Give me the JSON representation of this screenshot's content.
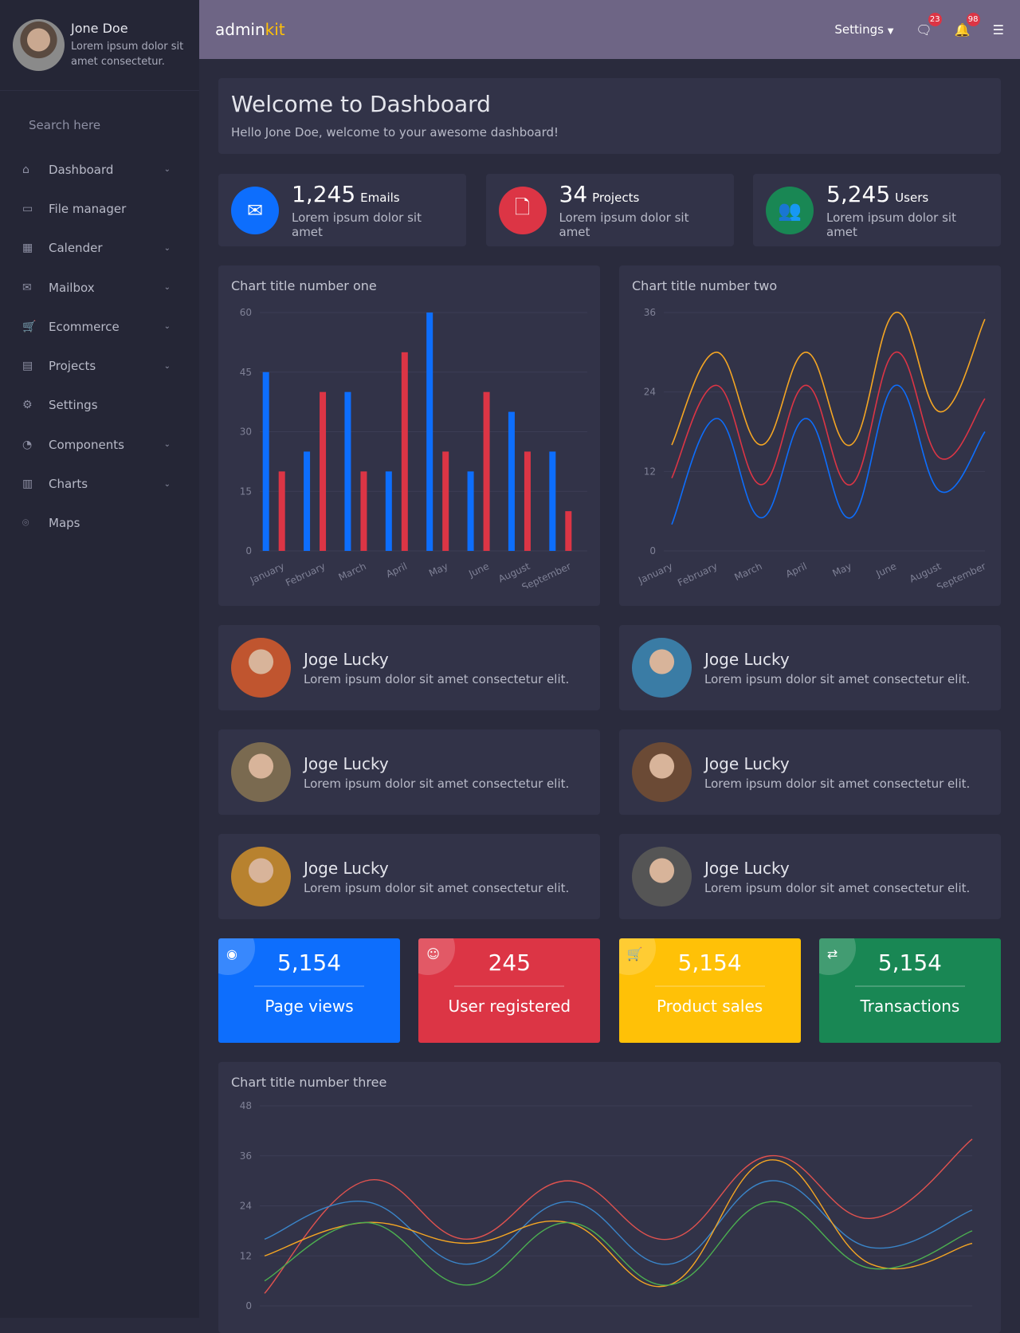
{
  "sidebar": {
    "user": {
      "name": "Jone Doe",
      "desc": "Lorem ipsum dolor sit amet consectetur."
    },
    "search_placeholder": "Search here",
    "items": [
      {
        "label": "Dashboard",
        "icon": "home-icon",
        "chevron": true
      },
      {
        "label": "File manager",
        "icon": "folder-icon",
        "chevron": false
      },
      {
        "label": "Calender",
        "icon": "calendar-icon",
        "chevron": true
      },
      {
        "label": "Mailbox",
        "icon": "mailbox-icon",
        "chevron": true
      },
      {
        "label": "Ecommerce",
        "icon": "cart-icon",
        "chevron": true
      },
      {
        "label": "Projects",
        "icon": "briefcase-icon",
        "chevron": true
      },
      {
        "label": "Settings",
        "icon": "gear-icon",
        "chevron": false
      },
      {
        "label": "Components",
        "icon": "pie-icon",
        "chevron": true
      },
      {
        "label": "Charts",
        "icon": "bar-chart-icon",
        "chevron": true
      },
      {
        "label": "Maps",
        "icon": "map-pin-icon",
        "chevron": false
      }
    ]
  },
  "header": {
    "brand_a": "admin",
    "brand_b": "kit",
    "settings": "Settings",
    "messages_count": "23",
    "notifications_count": "98"
  },
  "welcome": {
    "title": "Welcome to Dashboard",
    "subtitle": "Hello Jone Doe, welcome to your awesome dashboard!"
  },
  "stats": [
    {
      "value": "1,245",
      "unit": "Emails",
      "sub": "Lorem ipsum dolor sit amet",
      "color": "#0d6efd",
      "icon": "mail-icon"
    },
    {
      "value": "34",
      "unit": "Projects",
      "sub": "Lorem ipsum dolor sit amet",
      "color": "#dc3545",
      "icon": "file-icon"
    },
    {
      "value": "5,245",
      "unit": "Users",
      "sub": "Lorem ipsum dolor sit amet",
      "color": "#198754",
      "icon": "users-icon"
    }
  ],
  "people": [
    {
      "name": "Joge Lucky",
      "desc": "Lorem ipsum dolor sit amet consectetur elit."
    },
    {
      "name": "Joge Lucky",
      "desc": "Lorem ipsum dolor sit amet consectetur elit."
    },
    {
      "name": "Joge Lucky",
      "desc": "Lorem ipsum dolor sit amet consectetur elit."
    },
    {
      "name": "Joge Lucky",
      "desc": "Lorem ipsum dolor sit amet consectetur elit."
    },
    {
      "name": "Joge Lucky",
      "desc": "Lorem ipsum dolor sit amet consectetur elit."
    },
    {
      "name": "Joge Lucky",
      "desc": "Lorem ipsum dolor sit amet consectetur elit."
    }
  ],
  "tiles": [
    {
      "value": "5,154",
      "label": "Page views",
      "color": "#0d6efd",
      "icon": "eye-icon"
    },
    {
      "value": "245",
      "label": "User registered",
      "color": "#dc3545",
      "icon": "user-icon"
    },
    {
      "value": "5,154",
      "label": "Product sales",
      "color": "#ffc107",
      "icon": "cart-icon"
    },
    {
      "value": "5,154",
      "label": "Transactions",
      "color": "#198754",
      "icon": "transfer-icon"
    }
  ],
  "chart_data": [
    {
      "type": "bar",
      "title": "Chart title number one",
      "categories": [
        "January",
        "February",
        "March",
        "April",
        "May",
        "June",
        "August",
        "September"
      ],
      "ylim": [
        0,
        60
      ],
      "yticks": [
        0,
        15,
        30,
        45,
        60
      ],
      "grid": true,
      "series": [
        {
          "values": [
            45,
            25,
            40,
            20,
            60,
            20,
            35,
            25
          ],
          "color": "#0d6efd"
        },
        {
          "values": [
            20,
            40,
            20,
            50,
            25,
            40,
            25,
            10
          ],
          "color": "#dc3545"
        }
      ]
    },
    {
      "type": "line",
      "title": "Chart title number two",
      "categories": [
        "January",
        "February",
        "March",
        "April",
        "May",
        "June",
        "August",
        "September"
      ],
      "ylim": [
        0,
        36
      ],
      "yticks": [
        0,
        12,
        24,
        36
      ],
      "grid": true,
      "series": [
        {
          "values": [
            16,
            30,
            16,
            30,
            16,
            36,
            21,
            35
          ],
          "color": "#f5a623"
        },
        {
          "values": [
            11,
            25,
            10,
            25,
            10,
            30,
            14,
            23
          ],
          "color": "#dc3545"
        },
        {
          "values": [
            4,
            20,
            5,
            20,
            5,
            25,
            9,
            18
          ],
          "color": "#0d6efd"
        }
      ]
    },
    {
      "type": "line",
      "title": "Chart title number three",
      "ylim": [
        0,
        48
      ],
      "yticks": [
        0,
        12,
        24,
        36,
        48
      ],
      "grid": true,
      "series": [
        {
          "values": [
            3,
            30,
            16,
            30,
            16,
            36,
            21,
            40
          ],
          "color": "#e0524f"
        },
        {
          "values": [
            16,
            25,
            10,
            25,
            10,
            30,
            14,
            23
          ],
          "color": "#3a85c9"
        },
        {
          "values": [
            12,
            20,
            15,
            20,
            5,
            35,
            10,
            15
          ],
          "color": "#f5a623"
        },
        {
          "values": [
            6,
            20,
            5,
            20,
            5,
            25,
            9,
            18
          ],
          "color": "#4caf50"
        }
      ]
    }
  ]
}
